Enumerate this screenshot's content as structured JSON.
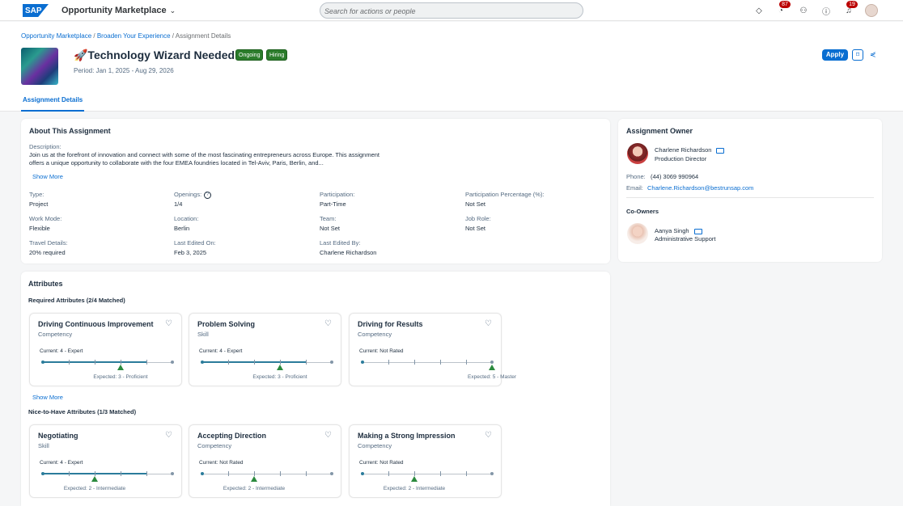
{
  "shell": {
    "logo": "SAP",
    "app_title": "Opportunity Marketplace",
    "search_placeholder": "Search for actions or people",
    "badge_tasks": "87",
    "badge_notifications": "19"
  },
  "header": {
    "breadcrumb": [
      "Opportunity Marketplace",
      "Broaden Your Experience",
      "Assignment Details"
    ],
    "title": "🚀Technology Wizard Needed",
    "tags": [
      "Ongoing",
      "Hiring"
    ],
    "period": "Period: Jan 1, 2025 - Aug 29, 2026",
    "apply_label": "Apply",
    "tab": "Assignment Details"
  },
  "about": {
    "title": "About This Assignment",
    "description_label": "Description:",
    "description": "Join us at the forefront of innovation and connect with some of the most fascinating entrepreneurs across Europe. This assignment offers a unique opportunity to collaborate with the four EMEA foundries located in Tel-Aviv, Paris, Berlin, and...",
    "show_more": "Show More",
    "fields": [
      {
        "label": "Type:",
        "value": "Project"
      },
      {
        "label": "Openings:",
        "value": "1/4"
      },
      {
        "label": "Participation:",
        "value": "Part-Time"
      },
      {
        "label": "Participation Percentage (%):",
        "value": "Not Set"
      },
      {
        "label": "Work Mode:",
        "value": "Flexible"
      },
      {
        "label": "Location:",
        "value": "Berlin"
      },
      {
        "label": "Team:",
        "value": "Not Set"
      },
      {
        "label": "Job Role:",
        "value": "Not Set"
      },
      {
        "label": "Travel Details:",
        "value": "20% required"
      },
      {
        "label": "Last Edited On:",
        "value": "Feb 3, 2025"
      },
      {
        "label": "Last Edited By:",
        "value": "Charlene Richardson"
      }
    ]
  },
  "owner": {
    "title": "Assignment Owner",
    "name": "Charlene Richardson",
    "role": "Production Director",
    "phone_label": "Phone:",
    "phone": "(44) 3069 990964",
    "email_label": "Email:",
    "email": "Charlene.Richardson@bestrunsap.com",
    "coowners_title": "Co-Owners",
    "coowner_name": "Aanya Singh",
    "coowner_role": "Administrative Support"
  },
  "attributes": {
    "title": "Attributes",
    "required_title": "Required Attributes (2/4 Matched)",
    "show_more": "Show More",
    "nice_title": "Nice-to-Have Attributes (1/3 Matched)",
    "required": [
      {
        "name": "Driving Continuous Improvement",
        "type": "Competency",
        "current": "Current: 4 - Expert",
        "current_level": 4,
        "expected": "Expected: 3 - Proficient",
        "expected_level": 3
      },
      {
        "name": "Problem Solving",
        "type": "Skill",
        "current": "Current: 4 - Expert",
        "current_level": 4,
        "expected": "Expected: 3 - Proficient",
        "expected_level": 3
      },
      {
        "name": "Driving for Results",
        "type": "Competency",
        "current": "Current: Not Rated",
        "current_level": 0,
        "expected": "Expected: 5 - Master",
        "expected_level": 5
      }
    ],
    "nice": [
      {
        "name": "Negotiating",
        "type": "Skill",
        "current": "Current: 4 - Expert",
        "current_level": 4,
        "expected": "Expected: 2 - Intermediate",
        "expected_level": 2
      },
      {
        "name": "Accepting Direction",
        "type": "Competency",
        "current": "Current: Not Rated",
        "current_level": 0,
        "expected": "Expected: 2 - Intermediate",
        "expected_level": 2
      },
      {
        "name": "Making a Strong Impression",
        "type": "Competency",
        "current": "Current: Not Rated",
        "current_level": 0,
        "expected": "Expected: 2 - Intermediate",
        "expected_level": 2
      }
    ]
  },
  "colors": {
    "brand": "#0a6ed1",
    "positive": "#2b7c2b",
    "badge": "#bb0000"
  }
}
